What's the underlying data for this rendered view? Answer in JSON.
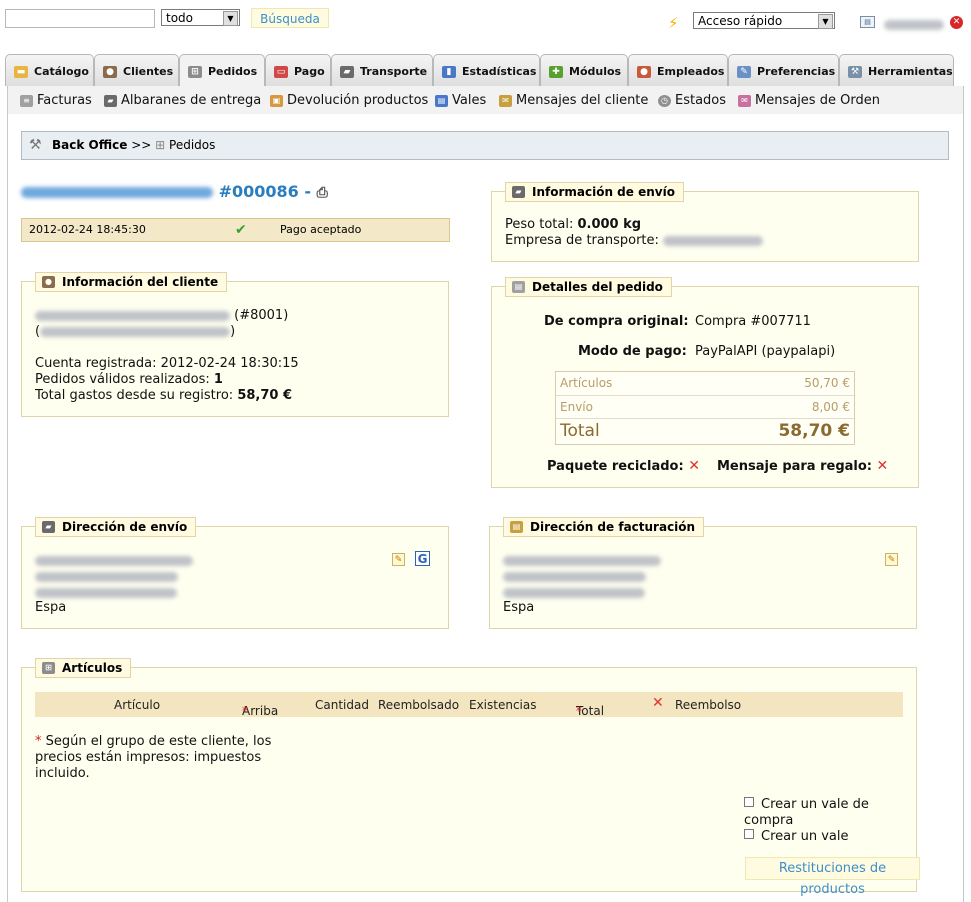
{
  "topbar": {
    "search_value": "",
    "scope_select": "todo",
    "search_button": "Búsqueda",
    "quick_access": "Acceso rápido"
  },
  "tabs": [
    {
      "label": "Catálogo"
    },
    {
      "label": "Clientes"
    },
    {
      "label": "Pedidos"
    },
    {
      "label": "Pago"
    },
    {
      "label": "Transporte"
    },
    {
      "label": "Estadísticas"
    },
    {
      "label": "Módulos"
    },
    {
      "label": "Empleados"
    },
    {
      "label": "Preferencias"
    },
    {
      "label": "Herramientas"
    }
  ],
  "submenu": [
    {
      "label": "Facturas"
    },
    {
      "label": "Albaranes de entrega"
    },
    {
      "label": "Devolución productos"
    },
    {
      "label": "Vales"
    },
    {
      "label": "Mensajes del cliente"
    },
    {
      "label": "Estados"
    },
    {
      "label": "Mensajes de Orden"
    }
  ],
  "breadcrumb": {
    "root": "Back Office",
    "separator": ">>",
    "current": "Pedidos"
  },
  "order": {
    "number": "#000086 -",
    "date": "2012-02-24 18:45:30",
    "status": "Pago aceptado"
  },
  "shipping_info": {
    "title": "Información de envío",
    "weight_label": "Peso total:",
    "weight_value": "0.000 kg",
    "carrier_label": "Empresa de transporte:"
  },
  "customer_info": {
    "title": "Información del cliente",
    "customer_id": "(#8001)",
    "paren_open": "(",
    "paren_close": ")",
    "registered_label": "Cuenta registrada:",
    "registered_value": "2012-02-24 18:30:15",
    "valid_orders_label": "Pedidos válidos realizados:",
    "valid_orders_value": "1",
    "total_spent_label": "Total gastos desde su registro:",
    "total_spent_value": "58,70 €"
  },
  "order_details": {
    "title": "Detalles del pedido",
    "original_label": "De compra original:",
    "original_value": "Compra #007711",
    "payment_label": "Modo de pago:",
    "payment_value": "PayPalAPI (paypalapi)",
    "products_label": "Artículos",
    "products_value": "50,70 €",
    "shipping_label": "Envío",
    "shipping_value": "8,00 €",
    "total_label": "Total",
    "total_value": "58,70 €",
    "recycled_label": "Paquete reciclado:",
    "gift_label": "Mensaje para regalo:"
  },
  "shipping_address": {
    "title": "Dirección de envío",
    "country": "Espa"
  },
  "billing_address": {
    "title": "Dirección de facturación",
    "country": "Espa"
  },
  "products": {
    "title": "Artículos",
    "columns": [
      "Artículo",
      "Arriba",
      "Cantidad",
      "Reembolsado",
      "Existencias",
      "Total",
      "Reembolso"
    ],
    "asterisk": "*",
    "note_line1": "Según el grupo de este cliente, los",
    "note_line2": "precios están impresos: impuestos",
    "note_line3": "incluido.",
    "voucher_line1": "Crear un vale de",
    "voucher_line2": "compra",
    "create_voucher": "Crear un vale",
    "refund_button": "Restituciones de productos"
  }
}
